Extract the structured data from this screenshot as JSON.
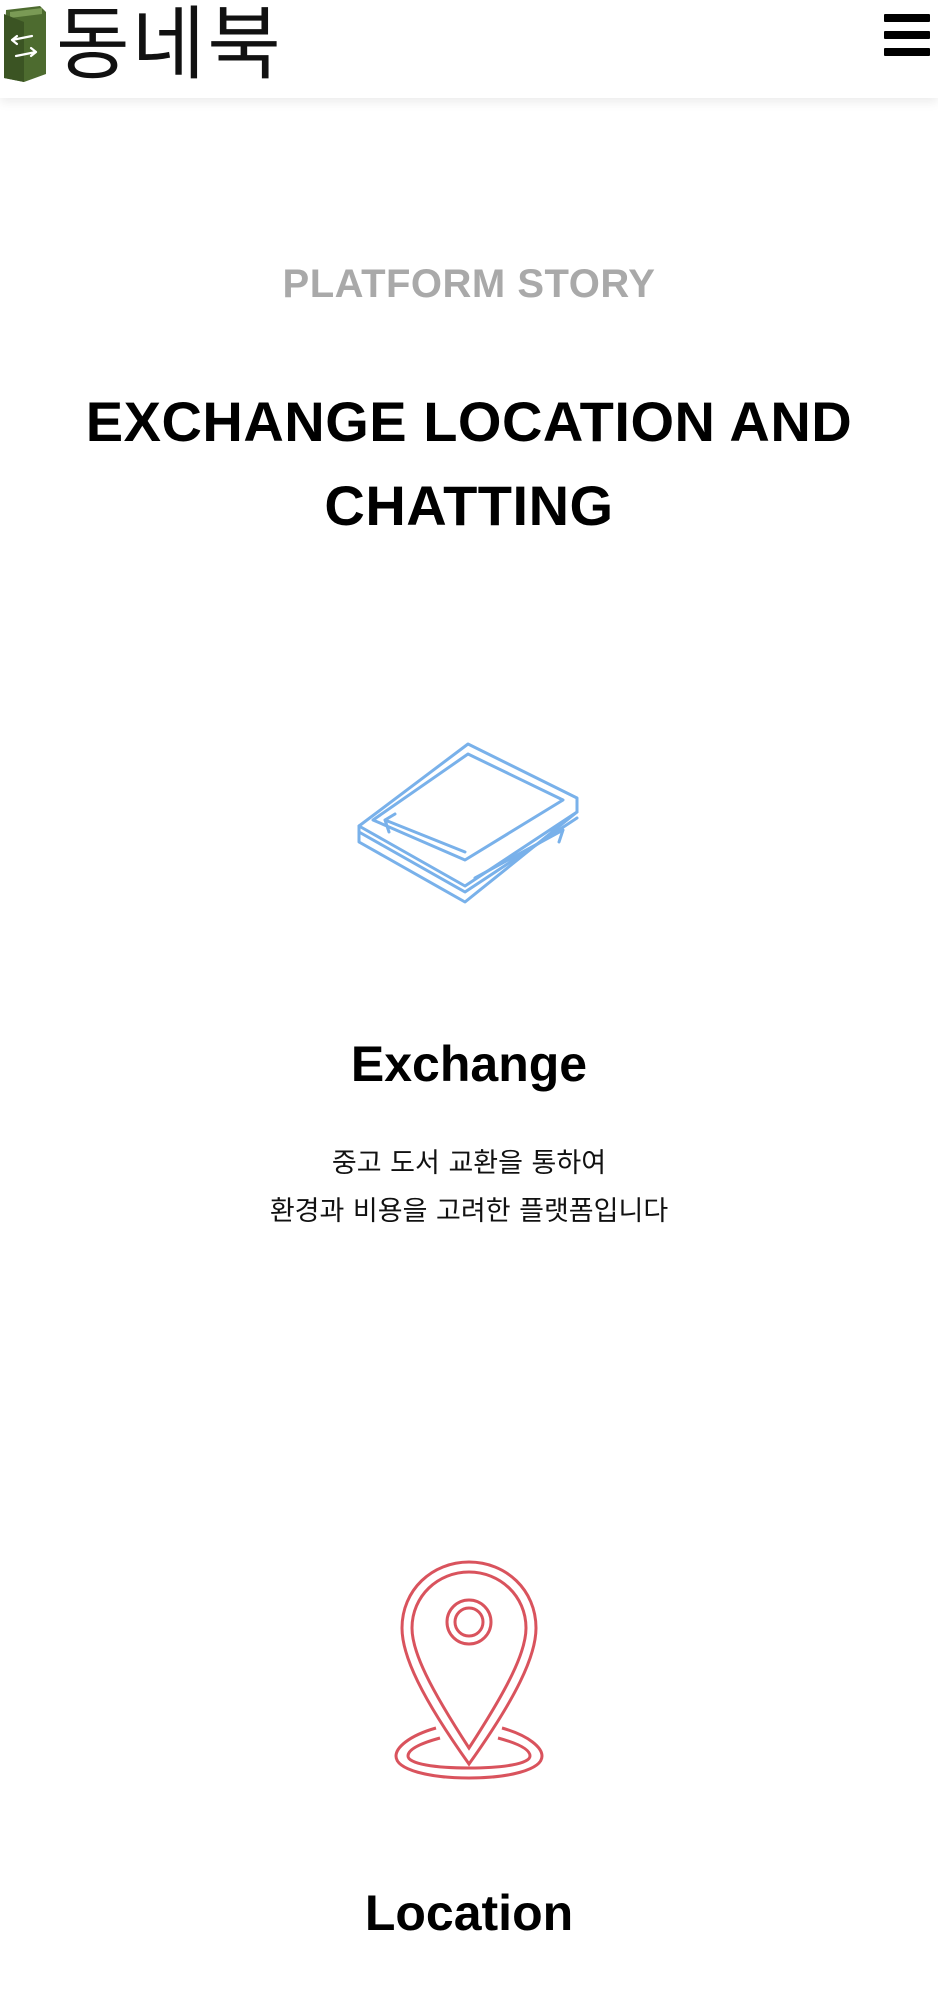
{
  "header": {
    "logo_text": "동네북",
    "menu_icon": "hamburger-menu-icon"
  },
  "colors": {
    "brand_green": "#4d6b2f",
    "exchange_icon_blue": "#79b1ea",
    "location_icon_red": "#d9535d",
    "label_gray": "#a9a9a9"
  },
  "section": {
    "label": "PLATFORM STORY",
    "title_line1": "EXCHANGE LOCATION AND",
    "title_line2": "CHATTING"
  },
  "features": [
    {
      "icon": "book-exchange-icon",
      "title": "Exchange",
      "desc_line1": "중고 도서 교환을 통하여",
      "desc_line2": "환경과 비용을 고려한 플랫폼입니다"
    },
    {
      "icon": "location-pin-icon",
      "title": "Location"
    }
  ]
}
